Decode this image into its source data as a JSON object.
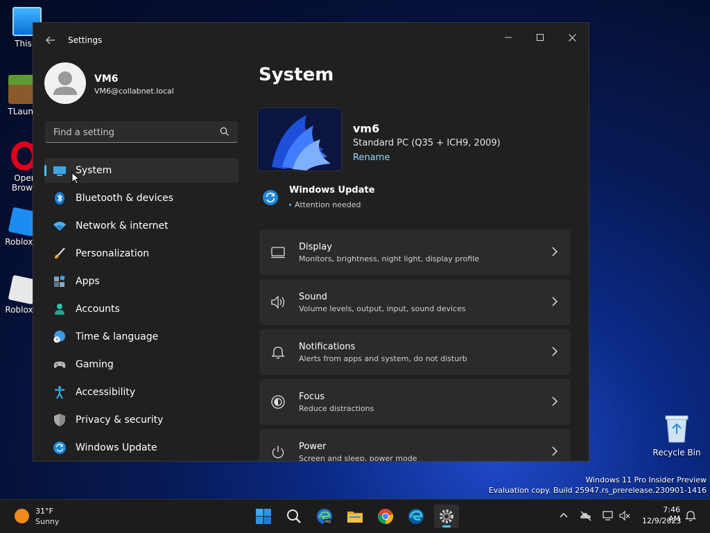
{
  "desktop": {
    "icons": [
      {
        "label": "This P"
      },
      {
        "label": "TLaunc"
      },
      {
        "label": "Oper",
        "label2": "Brows"
      },
      {
        "label": "Roblox S"
      },
      {
        "label": "Roblox P"
      }
    ],
    "recycle_bin": "Recycle Bin",
    "watermark": {
      "line1": "Windows 11 Pro Insider Preview",
      "line2": "Evaluation copy. Build 25947.rs_prerelease.230901-1416"
    }
  },
  "window": {
    "title": "Settings",
    "user": {
      "name": "VM6",
      "email": "VM6@collabnet.local"
    },
    "search": {
      "placeholder": "Find a setting",
      "value": ""
    },
    "nav": [
      {
        "label": "System",
        "icon": "system-icon"
      },
      {
        "label": "Bluetooth & devices",
        "icon": "bluetooth-icon"
      },
      {
        "label": "Network & internet",
        "icon": "wifi-icon"
      },
      {
        "label": "Personalization",
        "icon": "brush-icon"
      },
      {
        "label": "Apps",
        "icon": "apps-icon"
      },
      {
        "label": "Accounts",
        "icon": "person-icon"
      },
      {
        "label": "Time & language",
        "icon": "globe-clock-icon"
      },
      {
        "label": "Gaming",
        "icon": "gamepad-icon"
      },
      {
        "label": "Accessibility",
        "icon": "accessibility-icon"
      },
      {
        "label": "Privacy & security",
        "icon": "shield-icon"
      },
      {
        "label": "Windows Update",
        "icon": "update-icon"
      }
    ],
    "page": {
      "title": "System",
      "device": {
        "name": "vm6",
        "model": "Standard PC (Q35 + ICH9, 2009)",
        "rename": "Rename"
      },
      "update": {
        "title": "Windows Update",
        "status": "Attention needed"
      },
      "cards": [
        {
          "title": "Display",
          "subtitle": "Monitors, brightness, night light, display profile",
          "icon": "display-icon"
        },
        {
          "title": "Sound",
          "subtitle": "Volume levels, output, input, sound devices",
          "icon": "speaker-icon"
        },
        {
          "title": "Notifications",
          "subtitle": "Alerts from apps and system, do not disturb",
          "icon": "bell-icon"
        },
        {
          "title": "Focus",
          "subtitle": "Reduce distractions",
          "icon": "focus-icon"
        },
        {
          "title": "Power",
          "subtitle": "Screen and sleep, power mode",
          "icon": "power-icon"
        }
      ]
    }
  },
  "taskbar": {
    "weather": {
      "temp": "31°F",
      "condition": "Sunny"
    },
    "clock": {
      "time": "7:46 AM",
      "date": "12/9/2023"
    },
    "apps": [
      "start-icon",
      "search-icon",
      "edge-beta-icon",
      "file-explorer-icon",
      "chrome-icon",
      "edge-icon",
      "settings-icon"
    ]
  },
  "colors": {
    "accent": "#4cc2ff",
    "link": "#99d5ff",
    "window_bg": "#202020",
    "card_bg": "#2b2b2b"
  }
}
